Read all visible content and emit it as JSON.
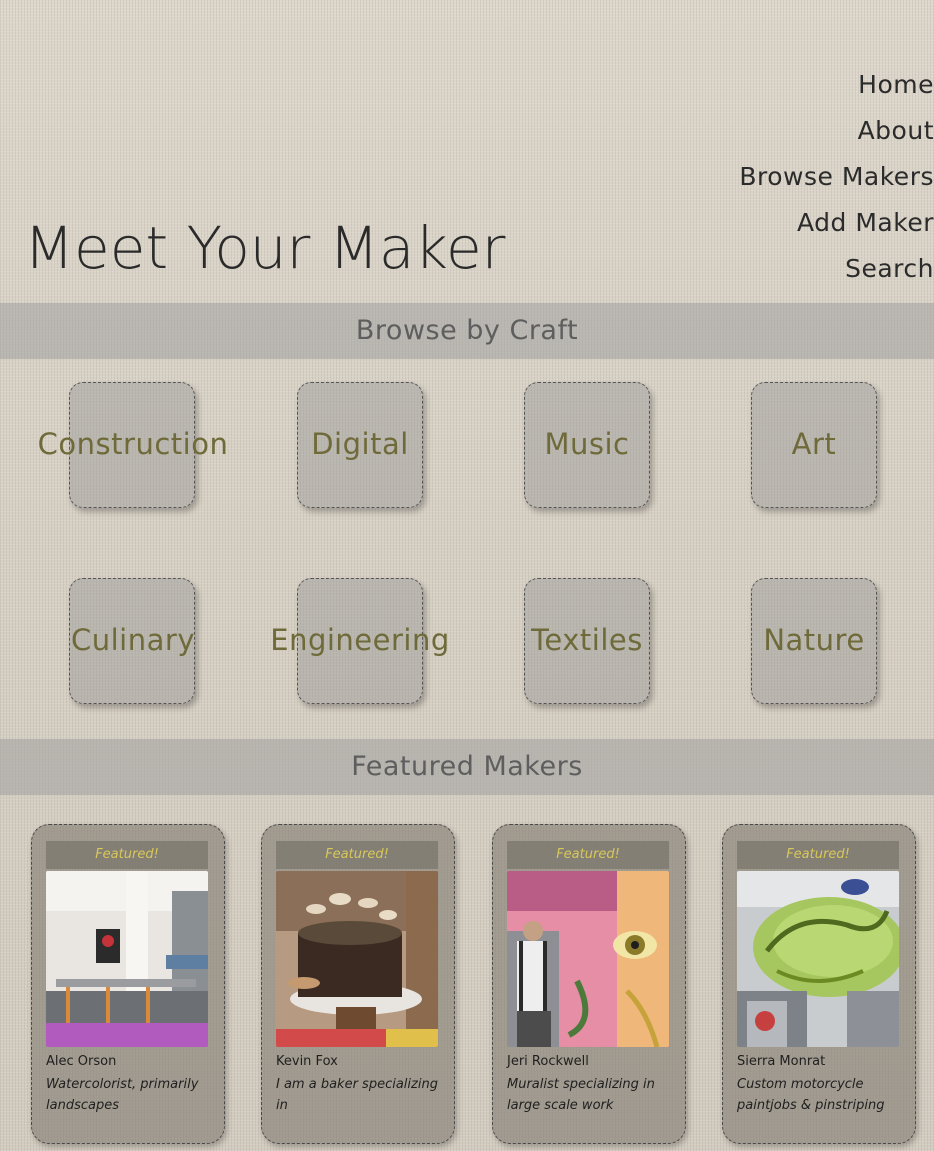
{
  "header": {
    "title": "Meet Your Maker"
  },
  "nav": {
    "items": [
      "Home",
      "About",
      "Browse Makers",
      "Add Maker",
      "Search"
    ]
  },
  "browse": {
    "heading": "Browse by Craft",
    "crafts": [
      "Construction",
      "Digital",
      "Music",
      "Art",
      "Culinary",
      "Engineering",
      "Textiles",
      "Nature"
    ]
  },
  "featured": {
    "heading": "Featured Makers",
    "badge": "Featured!",
    "makers": [
      {
        "name": "Alec Orson",
        "description": "Watercolorist, primarily landscapes"
      },
      {
        "name": "Kevin Fox",
        "description": "I am a baker specializing in"
      },
      {
        "name": "Jeri Rockwell",
        "description": "Muralist specializing in large scale work"
      },
      {
        "name": "Sierra Monrat",
        "description": "Custom motorcycle paintjobs & pinstriping"
      }
    ]
  },
  "colors": {
    "craft_label": "#6f6a3a",
    "featured_badge": "#d8c85a",
    "band": "#a0a0a0"
  }
}
